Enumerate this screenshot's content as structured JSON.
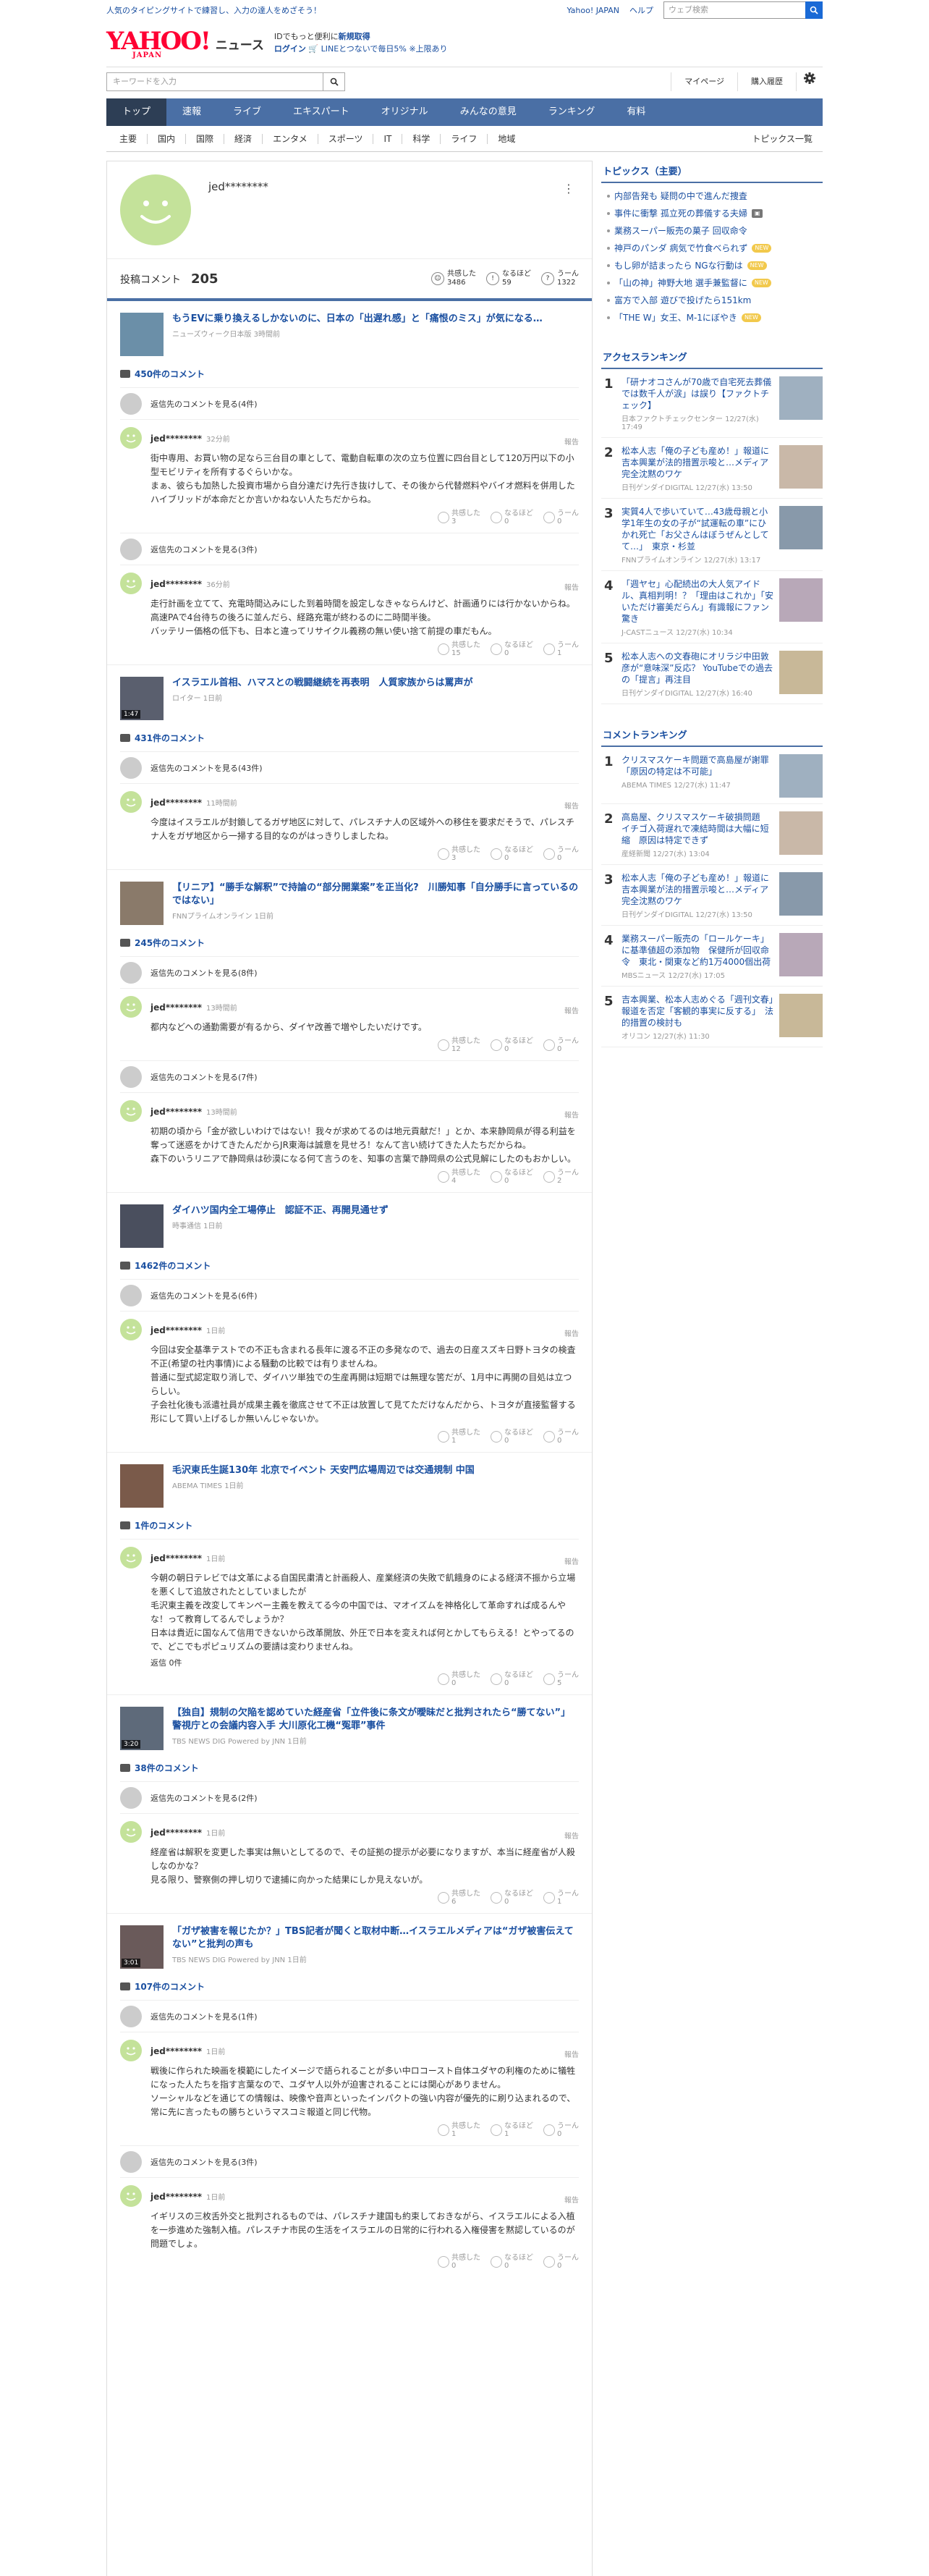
{
  "top": {
    "promo": "人気のタイピングサイトで練習し、入力の達人をめざそう！",
    "links": [
      "Yahoo! JAPAN",
      "ヘルプ"
    ],
    "search_placeholder": "ウェブ検索"
  },
  "header": {
    "logo": "YAHOO!",
    "logo_sub": "JAPAN",
    "service": "ニュース",
    "promo_line1_pre": "IDでもっと便利に",
    "promo_line1_link": "新規取得",
    "promo_line2_pre": "ログイン",
    "promo_line2_link": "🛒 LINEとつないで毎日5% ※上限あり"
  },
  "search": {
    "placeholder": "キーワードを入力",
    "mypage": "マイページ",
    "purchase": "購入履歴"
  },
  "gnav": [
    "トップ",
    "速報",
    "ライブ",
    "エキスパート",
    "オリジナル",
    "みんなの意見",
    "ランキング",
    "有料"
  ],
  "cnav": {
    "cats": [
      "主要",
      "国内",
      "国際",
      "経済",
      "エンタメ",
      "スポーツ",
      "IT",
      "科学",
      "ライフ",
      "地域"
    ],
    "all": "トピックス一覧"
  },
  "profile": {
    "name": "jed********",
    "label": "投稿コメント",
    "count": "205",
    "reactions": [
      {
        "label": "共感した",
        "value": "3486"
      },
      {
        "label": "なるほど",
        "value": "59"
      },
      {
        "label": "うーん",
        "value": "1322"
      }
    ]
  },
  "reaction_labels": [
    "共感した",
    "なるほど",
    "うーん"
  ],
  "report": "報告",
  "articles": [
    {
      "title": "もうEVに乗り換えるしかないのに、日本の「出遅れ感」と「痛恨のミス」が気になる…",
      "meta": "ニューズウィーク日本版 3時間前",
      "video": "",
      "count": "450件のコメント",
      "comments": [
        {
          "reply": "返信先のコメントを見る(4件)",
          "time": "32分前",
          "body": "街中専用、お買い物の足なら三台目の車として、電動自転車の次の立ち位置に四台目として120万円以下の小型モビリティを所有するぐらいかな。\nまぁ、彼らも加熱した投資市場から自分達だけ先行き抜けして、その後から代替燃料やバイオ燃料を併用したハイブリッドが本命だとか言いかねない人たちだからね。",
          "r": [
            "3",
            "0",
            "0"
          ]
        },
        {
          "reply": "返信先のコメントを見る(3件)",
          "time": "36分前",
          "body": "走行計画を立てて、充電時間込みにした到着時間を設定しなきゃならんけど、計画通りには行かないからね。\n高速PAで4台待ちの後ろに並んだら、経路充電が終わるのに二時間半後。\nバッテリー価格の低下も、日本と違ってリサイクル義務の無い使い捨て前提の車だもん。",
          "r": [
            "15",
            "0",
            "1"
          ]
        }
      ]
    },
    {
      "title": "イスラエル首相、ハマスとの戦闘継続を再表明　人質家族からは罵声が",
      "meta": "ロイター 1日前",
      "video": "1:47",
      "count": "431件のコメント",
      "comments": [
        {
          "reply": "返信先のコメントを見る(43件)",
          "time": "11時間前",
          "body": "今度はイスラエルが封鎖してるガザ地区に対して、パレスチナ人の区域外への移住を要求だそうで、パレスチナ人をガザ地区から一掃する目的なのがはっきりしましたね。",
          "r": [
            "3",
            "0",
            "0"
          ]
        }
      ]
    },
    {
      "title": "【リニア】“勝手な解釈”で持論の“部分開業案”を正当化?　川勝知事「自分勝手に言っているのではない」",
      "meta": "FNNプライムオンライン 1日前",
      "video": "",
      "count": "245件のコメント",
      "comments": [
        {
          "reply": "返信先のコメントを見る(8件)",
          "time": "13時間前",
          "body": "都内などへの通勤需要が有るから、ダイヤ改善で増やしたいだけです。",
          "r": [
            "12",
            "0",
            "0"
          ]
        },
        {
          "reply": "返信先のコメントを見る(7件)",
          "time": "13時間前",
          "body": "初期の頃から「金が欲しいわけではない！我々が求めてるのは地元貢献だ！」とか、本来静岡県が得る利益を奪って迷惑をかけてきたんだからJR東海は誠意を見せろ！なんて言い続けてきた人たちだからね。\n森下のいうリニアで静岡県は砂漠になる何て言うのを、知事の言葉で静岡県の公式見解にしたのもおかしい。",
          "r": [
            "4",
            "0",
            "2"
          ]
        }
      ]
    },
    {
      "title": "ダイハツ国内全工場停止　認証不正、再開見通せず",
      "meta": "時事通信 1日前",
      "video": "",
      "count": "1462件のコメント",
      "comments": [
        {
          "reply": "返信先のコメントを見る(6件)",
          "time": "1日前",
          "body": "今回は安全基準テストでの不正も含まれる長年に渡る不正の多発なので、過去の日産スズキ日野トヨタの検査不正(希望の社内事情)による騒動の比較では有りませんね。\n普通に型式認定取り消しで、ダイハツ単独での生産再開は短期では無理な筈だが、1月中に再開の目処は立つらしい。\n子会社化後も派遣社員が成果主義を徹底させて不正は放置して見てただけなんだから、トヨタが直接監督する形にして買い上げるしか無いんじゃないか。",
          "r": [
            "1",
            "0",
            "0"
          ]
        }
      ]
    },
    {
      "title": "毛沢東氏生誕130年 北京でイベント 天安門広場周辺では交通規制 中国",
      "meta": "ABEMA TIMES 1日前",
      "video": "",
      "count": "1件のコメント",
      "comments": [
        {
          "reply": "",
          "time": "1日前",
          "body": "今朝の朝日テレビでは文革による自国民粛清と計画殺人、産業経済の失敗で飢餓身のによる経済不振から立場を悪くして追放されたとしていましたが\n毛沢東主義を改変してキンペー主義を教えてる今の中国では、マオイズムを神格化して革命すれば成るんやな！って教育してるんでしょうか？\n日本は貴近に国なんて信用できないから改革開放、外圧で日本を変えれば何とかしてもらえる！とやってるので、どこでもポピュリズムの要請は変わりませんね。",
          "r": [
            "0",
            "0",
            "5"
          ],
          "reply_btn": "返信 0件"
        }
      ]
    },
    {
      "title": "【独自】規制の欠陥を認めていた経産省「立件後に条文が曖昧だと批判されたら“勝てない”」警視庁との会議内容入手 大川原化工機“冤罪”事件",
      "meta": "TBS NEWS DIG Powered by JNN 1日前",
      "video": "3:20",
      "count": "38件のコメント",
      "comments": [
        {
          "reply": "返信先のコメントを見る(2件)",
          "time": "1日前",
          "body": "経産省は解釈を変更した事実は無いとしてるので、その証拠の提示が必要になりますが、本当に経産省が人殺しなのかな？\n見る限り、警察側の押し切りで逮捕に向かった結果にしか見えないが。",
          "r": [
            "6",
            "0",
            "1"
          ]
        }
      ]
    },
    {
      "title": "「ガザ被害を報じたか？」TBS記者が聞くと取材中断…イスラエルメディアは“ガザ被害伝えてない”と批判の声も",
      "meta": "TBS NEWS DIG Powered by JNN 1日前",
      "video": "3:01",
      "count": "107件のコメント",
      "comments": [
        {
          "reply": "返信先のコメントを見る(1件)",
          "time": "1日前",
          "body": "戦後に作られた映画を模範にしたイメージで語られることが多い中ロコースト自体ユダヤの利権のために犠牲になった人たちを指す言葉なので、ユダヤ人以外が迫害されることには関心がありません。\nソーシャルなどを通じての情報は、映像や音声といったインパクトの強い内容が優先的に刷り込まれるので、常に先に言ったもの勝ちというマスコミ報道と同じ代物。",
          "r": [
            "1",
            "1",
            "0"
          ]
        },
        {
          "reply": "返信先のコメントを見る(3件)",
          "time": "1日前",
          "body": "イギリスの三枚舌外交と批判されるものでは、パレスチナ建国も約束しておきながら、イスラエルによる入植を一歩進めた強制入植。パレスチナ市民の生活をイスラエルの日常的に行われる入権侵害を黙認しているのが問題でしょ。",
          "r": [
            "0",
            "0",
            "0"
          ]
        }
      ]
    }
  ],
  "topics": {
    "title": "トピックス（主要）",
    "items": [
      {
        "t": "内部告発も 疑問の中で進んだ捜査",
        "b": ""
      },
      {
        "t": "事件に衝撃 孤立死の葬儀する夫婦",
        "b": "img"
      },
      {
        "t": "業務スーパー販売の菓子 回収命令",
        "b": ""
      },
      {
        "t": "神戸のパンダ 病気で竹食べられず",
        "b": "new"
      },
      {
        "t": "もし卵が詰まったら NGな行動は",
        "b": "new"
      },
      {
        "t": "「山の神」神野大地 選手兼監督に",
        "b": "new"
      },
      {
        "t": "富方で入部 遊びで投げたら151km",
        "b": ""
      },
      {
        "t": "「THE W」女王、M-1にぼやき",
        "b": "new"
      }
    ]
  },
  "access_ranking": {
    "title": "アクセスランキング",
    "items": [
      {
        "t": "「研ナオコさんが70歳で自宅死去葬儀では数千人が涙」は誤り【ファクトチェック】",
        "s": "日本ファクトチェックセンター 12/27(水) 17:49"
      },
      {
        "t": "松本人志「俺の子ども産め！」報道に吉本興業が法的措置示唆と…メディア完全沈黙のワケ",
        "s": "日刊ゲンダイDIGITAL 12/27(水) 13:50"
      },
      {
        "t": "実質4人で歩いていて…43歳母親と小学1年生の女の子が“試運転の車”にひかれ死亡「お父さんはぼうぜんとしてて…」　東京・杉並",
        "s": "FNNプライムオンライン 12/27(水) 13:17"
      },
      {
        "t": "「週ヤセ」心配続出の大人気アイドル、真相判明！？「理由はこれか」「安いただけ審美だらん」有識報にファン驚き",
        "s": "J-CASTニュース 12/27(水) 10:34"
      },
      {
        "t": "松本人志への文春砲にオリラジ中田敦彦が“意味深”反応？ YouTubeでの過去の「提言」再注目",
        "s": "日刊ゲンダイDIGITAL 12/27(水) 16:40"
      }
    ]
  },
  "comment_ranking": {
    "title": "コメントランキング",
    "items": [
      {
        "t": "クリスマスケーキ問題で高島屋が謝罪「原因の特定は不可能」",
        "s": "ABEMA TIMES 12/27(水) 11:47"
      },
      {
        "t": "高島屋、クリスマスケーキ破損問題　イチゴ入荷遅れで凍結時間は大幅に短縮　原因は特定できず",
        "s": "産経新聞 12/27(水) 13:04"
      },
      {
        "t": "松本人志「俺の子ども産め！」報道に吉本興業が法的措置示唆と…メディア完全沈黙のワケ",
        "s": "日刊ゲンダイDIGITAL 12/27(水) 13:50"
      },
      {
        "t": "業務スーパー販売の「ロールケーキ」に基準値超の添加物　保健所が回収命令　東北・関東など約1万4000個出荷",
        "s": "MBSニュース 12/27(水) 17:05"
      },
      {
        "t": "吉本興業、松本人志めぐる「週刊文春」報道を否定「客観的事実に反する」　法的措置の検討も",
        "s": "オリコン 12/27(水) 11:30"
      }
    ]
  }
}
